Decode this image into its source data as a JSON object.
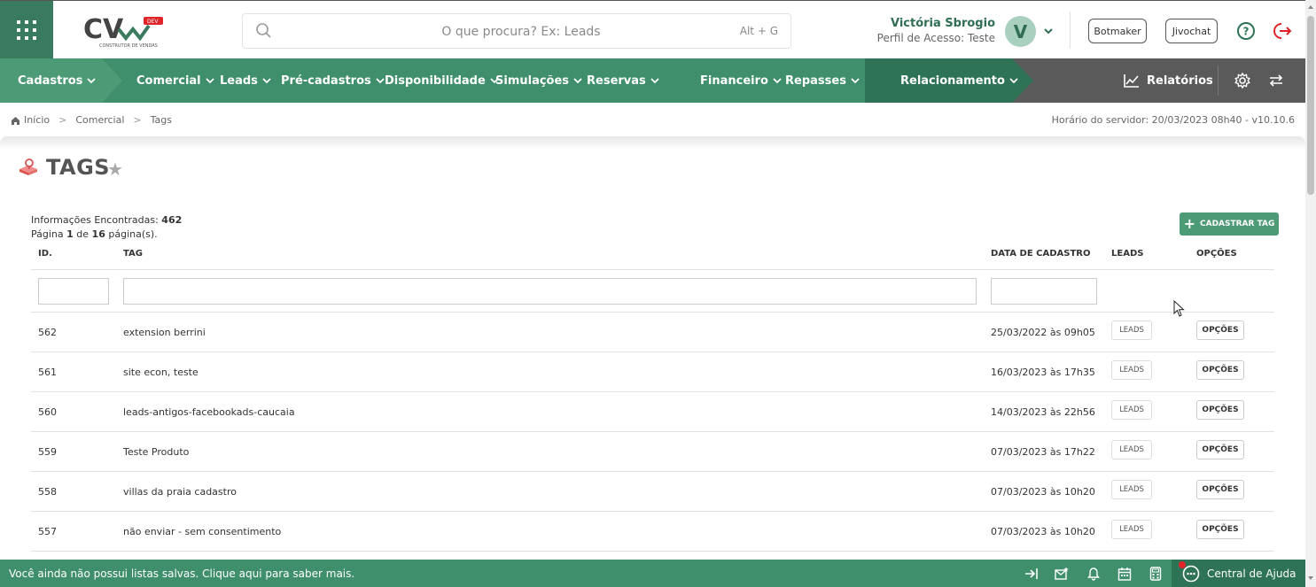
{
  "header": {
    "logo_text": "CV",
    "logo_badge": "DEV",
    "logo_sub": "CONSTRUTOR DE VENDAS",
    "search_placeholder": "O que procura? Ex: Leads",
    "search_shortcut": "Alt + G",
    "user_name": "Victória Sbrogio",
    "user_profile": "Perfil de Acesso: Teste",
    "avatar_letter": "V",
    "botmaker_label": "Botmaker",
    "jivochat_label": "Jivochat"
  },
  "nav": {
    "items": [
      {
        "label": "Cadastros"
      },
      {
        "label": "Comercial"
      },
      {
        "label": "Leads"
      },
      {
        "label": "Pré-cadastros"
      },
      {
        "label": "Disponibilidade"
      },
      {
        "label": "Simulações"
      },
      {
        "label": "Reservas"
      },
      {
        "label": "Financeiro"
      },
      {
        "label": "Repasses"
      },
      {
        "label": "Relacionamento"
      }
    ],
    "reports_label": "Relatórios"
  },
  "breadcrumb": {
    "home": "Início",
    "level1": "Comercial",
    "level2": "Tags"
  },
  "server_time": "Horário do servidor: 20/03/2023 08h40 - v10.10.6",
  "page": {
    "title": "TAGS",
    "info_found_label": "Informações Encontradas:",
    "info_found_count": "462",
    "page_prefix": "Página",
    "page_current": "1",
    "page_of": "de",
    "page_total": "16",
    "page_suffix": "página(s).",
    "add_button": "CADASTRAR TAG"
  },
  "table": {
    "headers": {
      "id": "ID.",
      "tag": "TAG",
      "date": "DATA DE CADASTRO",
      "leads": "LEADS",
      "options": "OPÇÕES"
    },
    "leads_button": "LEADS",
    "options_button": "OPÇÕES",
    "rows": [
      {
        "id": "562",
        "tag": "extension berrini",
        "date": "25/03/2022 às 09h05"
      },
      {
        "id": "561",
        "tag": "site econ, teste",
        "date": "16/03/2023 às 17h35"
      },
      {
        "id": "560",
        "tag": "leads-antigos-facebookads-caucaia",
        "date": "14/03/2023 às 22h56"
      },
      {
        "id": "559",
        "tag": "Teste Produto",
        "date": "07/03/2023 às 17h22"
      },
      {
        "id": "558",
        "tag": "villas da praia cadastro",
        "date": "07/03/2023 às 10h20"
      },
      {
        "id": "557",
        "tag": "não enviar - sem consentimento",
        "date": "07/03/2023 às 10h20"
      }
    ]
  },
  "bottombar": {
    "message": "Você ainda não possui listas salvas. Clique aqui para saber mais.",
    "help_center": "Central de Ajuda"
  },
  "colors": {
    "brand_green": "#3f8f6c",
    "dark_green": "#2f7356",
    "nav_gray": "#5a5a5a",
    "logout_red": "#e0242a"
  }
}
